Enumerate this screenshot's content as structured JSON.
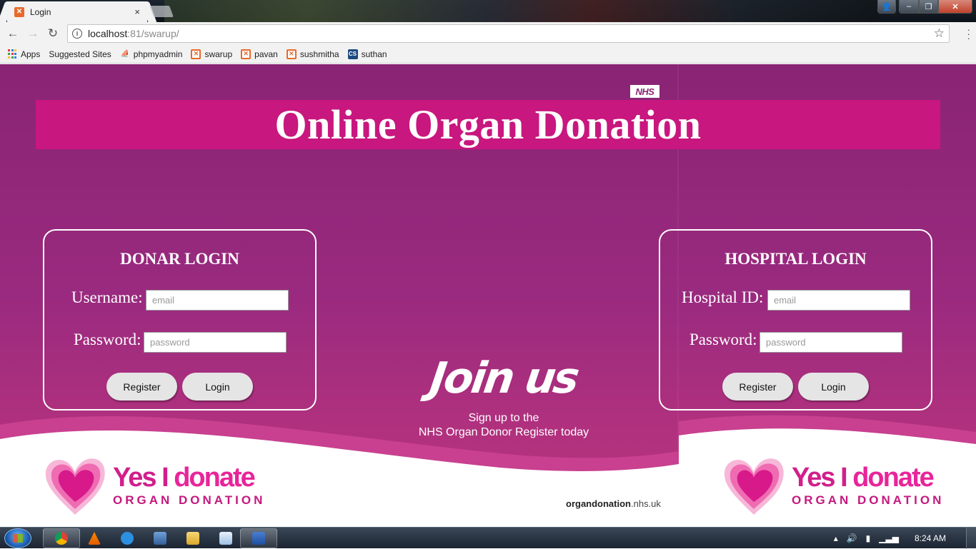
{
  "browser": {
    "tab_title": "Login",
    "tab_close": "×",
    "url_host": "localhost",
    "url_rest": ":81/swarup/",
    "star_glyph": "☆",
    "bookmarks": [
      {
        "label": "Apps",
        "icon": "apps-icon"
      },
      {
        "label": "Suggested Sites",
        "icon": "page-icon"
      },
      {
        "label": "phpmyadmin",
        "icon": "phpmyadmin-icon"
      },
      {
        "label": "swarup",
        "icon": "xampp-icon"
      },
      {
        "label": "pavan",
        "icon": "xampp-icon"
      },
      {
        "label": "sushmitha",
        "icon": "xampp-icon"
      },
      {
        "label": "suthan",
        "icon": "cs-icon"
      }
    ]
  },
  "page": {
    "nhs_logo": "NHS",
    "title": "Online Organ Donation",
    "donor_login": {
      "heading": "DONAR LOGIN",
      "username_label": "Username:",
      "username_placeholder": "email",
      "password_label": "Password:",
      "password_placeholder": "password",
      "register_label": "Register",
      "login_label": "Login"
    },
    "hospital_login": {
      "heading": "HOSPITAL LOGIN",
      "id_label": "Hospital ID:",
      "id_placeholder": "email",
      "password_label": "Password:",
      "password_placeholder": "password",
      "register_label": "Register",
      "login_label": "Login"
    },
    "join_us": {
      "headline": "Join us",
      "line1": "Sign up to the",
      "line2": "NHS Organ Donor Register today"
    },
    "yes_donate": {
      "line1_a": "Yes I ",
      "line1_b": "donate",
      "line2": "ORGAN DONATION"
    },
    "site_url_bold": "organdonation",
    "site_url_rest": ".nhs.uk"
  },
  "taskbar": {
    "clock": "8:24 AM"
  },
  "colors": {
    "page_bg": "#8a2474",
    "banner": "#c8177e",
    "brand_pink": "#d11f8b"
  }
}
